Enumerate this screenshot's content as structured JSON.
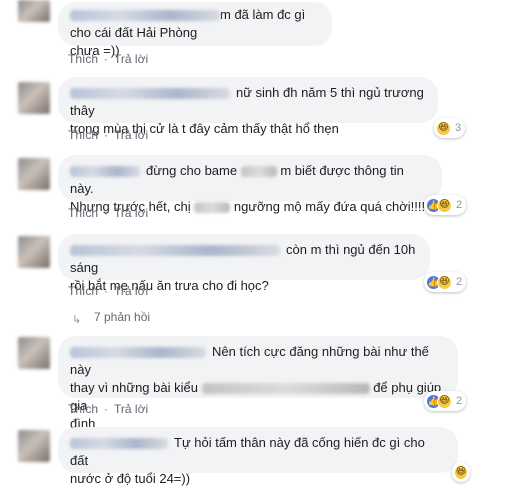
{
  "actions": {
    "like": "Thích",
    "reply": "Trả lời",
    "separator": "·"
  },
  "comments": [
    {
      "line1": "m đã làm đc gì cho cái đất Hải Phòng",
      "line2": "chưa =))"
    },
    {
      "line1": "nữ sinh đh năm 5 thì ngủ trương thây",
      "line2": "trong mùa thi cử là t đây cảm thấy thật hổ thẹn",
      "reaction_count": "3"
    },
    {
      "line1a": "đừng cho bame",
      "line1b": "m biết được thông tin này.",
      "line2a": "Nhưng trước hết, chị",
      "line2b": "ngưỡng mộ mấy đứa quá chời!!!!",
      "reaction_count": "2"
    },
    {
      "line1": "còn m thì ngủ đến 10h sáng",
      "line2": "rồi bắt mẹ nấu ăn trưa cho đi học?",
      "reaction_count": "2",
      "replies": "7 phản hồi"
    },
    {
      "line1": "Nên tích cực đăng những bài như thế này",
      "line2": "thay vì những bài kiểu",
      "line2b": "để phụ giúp gia",
      "line3": "đình",
      "reaction_count": "2"
    },
    {
      "line1": "Tự hỏi tấm thân này đã cống hiến đc gì cho đất",
      "line2": "nước ở độ tuổi 24=))"
    }
  ]
}
